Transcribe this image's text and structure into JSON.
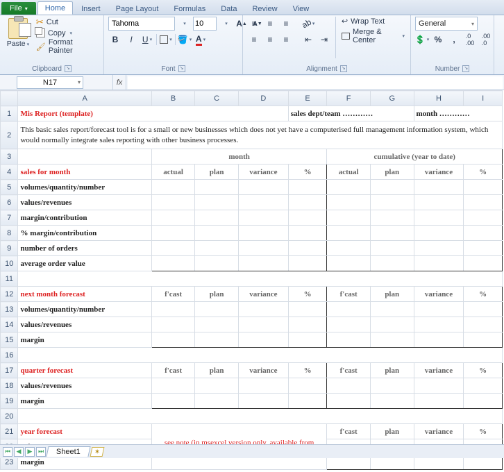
{
  "tabs": {
    "file": "File",
    "home": "Home",
    "insert": "Insert",
    "page_layout": "Page Layout",
    "formulas": "Formulas",
    "data": "Data",
    "review": "Review",
    "view": "View"
  },
  "clipboard": {
    "paste": "Paste",
    "cut": "Cut",
    "copy": "Copy",
    "format_painter": "Format Painter",
    "title": "Clipboard"
  },
  "font": {
    "name": "Tahoma",
    "size": "10",
    "title": "Font"
  },
  "alignment": {
    "wrap": "Wrap Text",
    "merge": "Merge & Center",
    "title": "Alignment"
  },
  "number": {
    "format": "General",
    "title": "Number"
  },
  "namebox": "N17",
  "formula": "",
  "cols": [
    "A",
    "B",
    "C",
    "D",
    "E",
    "F",
    "G",
    "H",
    "I"
  ],
  "rows": [
    "1",
    "2",
    "3",
    "4",
    "5",
    "6",
    "7",
    "8",
    "9",
    "10",
    "11",
    "12",
    "13",
    "14",
    "15",
    "16",
    "17",
    "18",
    "19",
    "20",
    "21",
    "22",
    "23"
  ],
  "sheet": {
    "title": "Mis Report (template)",
    "dept": "sales dept/team …………",
    "month": "month …………",
    "desc": "This basic sales report/forecast tool is for a small or new businesses which does not yet have a computerised full management information system, which would normally integrate sales reporting with other business processes.",
    "grp_month": "month",
    "grp_cum": "cumulative (year to date)",
    "h_actual": "actual",
    "h_plan": "plan",
    "h_var": "variance",
    "h_pct": "%",
    "h_fcast": "f'cast",
    "s_sales": "sales for month",
    "r_vqn": "volumes/quantity/number",
    "r_val": "values/revenues",
    "r_mar": "margin/contribution",
    "r_pmar": "% margin/contribution",
    "r_ord": "number of orders",
    "r_avg": "average order value",
    "s_next": "next month forecast",
    "r_margin": "margin",
    "s_qtr": "quarter forecast",
    "s_year": "year forecast",
    "note": "see note (in msexcel version only, available from businessballs.com)"
  },
  "sheettab": "Sheet1"
}
